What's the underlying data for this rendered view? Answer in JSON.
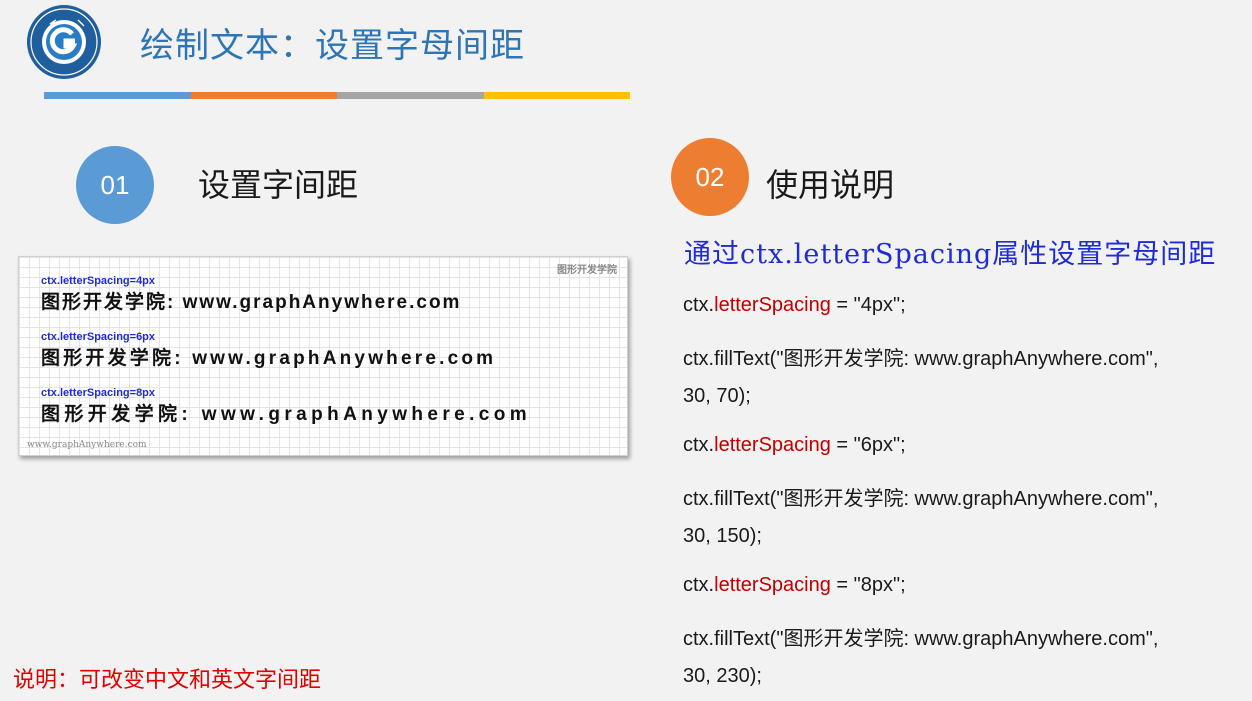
{
  "header": {
    "title": "绘制文本：设置字母间距",
    "bar_colors": [
      "#5b9bd5",
      "#ed7d31",
      "#a5a5a5",
      "#ffc000"
    ],
    "logo": {
      "text_top": "图形开发学院",
      "text_bottom": "GRAPH ANY WHERE",
      "letter": "G"
    }
  },
  "sections": [
    {
      "number": "01",
      "title": "设置字间距",
      "color": "#5b9bd5"
    },
    {
      "number": "02",
      "title": "使用说明",
      "color": "#ed7d31"
    }
  ],
  "demo": {
    "watermark_top": "图形开发学院",
    "watermark_bottom": "www.graphAnywhere.com",
    "rows": [
      {
        "caption": "ctx.letterSpacing=4px",
        "text": "图形开发学院: www.graphAnywhere.com"
      },
      {
        "caption": "ctx.letterSpacing=6px",
        "text": "图形开发学院: www.graphAnywhere.com"
      },
      {
        "caption": "ctx.letterSpacing=8px",
        "text": "图形开发学院: www.graphAnywhere.com"
      }
    ]
  },
  "usage": {
    "heading": "通过ctx.letterSpacing属性设置字母间距",
    "lines": [
      {
        "pre": "ctx.",
        "kw": "letterSpacing",
        "post": " = \"4px\";"
      },
      {
        "pre": "ctx.fillText(\"图形开发学院: www.graphAnywhere.com\",",
        "kw": "",
        "post": ""
      },
      {
        "pre": "30, 70);",
        "kw": "",
        "post": ""
      },
      {
        "pre": "ctx.",
        "kw": "letterSpacing",
        "post": " = \"6px\";"
      },
      {
        "pre": "ctx.fillText(\"图形开发学院: www.graphAnywhere.com\",",
        "kw": "",
        "post": ""
      },
      {
        "pre": "30, 150);",
        "kw": "",
        "post": ""
      },
      {
        "pre": "ctx.",
        "kw": "letterSpacing",
        "post": " = \"8px\";"
      },
      {
        "pre": "ctx.fillText(\"图形开发学院: www.graphAnywhere.com\",",
        "kw": "",
        "post": ""
      },
      {
        "pre": "30, 230);",
        "kw": "",
        "post": ""
      }
    ]
  },
  "note": "说明：可改变中文和英文字间距"
}
